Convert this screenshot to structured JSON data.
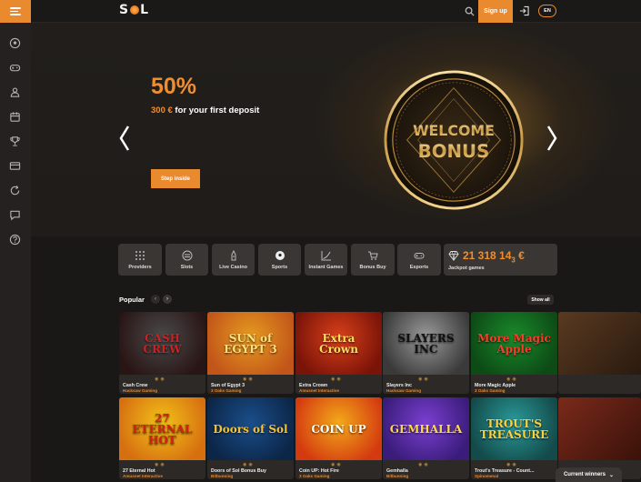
{
  "header": {
    "logo_text": "SOL",
    "signup_label": "Sign up",
    "lang_label": "EN"
  },
  "sidebar": {
    "icons": [
      "soccer-ball-icon",
      "gamepad-icon",
      "dealer-icon",
      "calendar-icon",
      "trophy-icon",
      "card-icon",
      "refresh-bonus-icon",
      "chat-icon",
      "help-icon"
    ]
  },
  "hero": {
    "percent": "50%",
    "amount": "300 €",
    "subtitle_rest": " for your first deposit",
    "cta_label": "Step inside",
    "badge_line1": "WELCOME",
    "badge_line2": "BONUS"
  },
  "categories": [
    {
      "label": "Providers",
      "icon": "grid-icon"
    },
    {
      "label": "Slots",
      "icon": "slot-icon"
    },
    {
      "label": "Live Casino",
      "icon": "dealer-icon"
    },
    {
      "label": "Sports",
      "icon": "soccer-ball-icon"
    },
    {
      "label": "Instant Games",
      "icon": "chart-icon"
    },
    {
      "label": "Bonus Buy",
      "icon": "cart-icon"
    },
    {
      "label": "Esports",
      "icon": "gamepad-icon"
    }
  ],
  "jackpot": {
    "value_main": "21 318 14",
    "value_sub": "3",
    "value_cur": " €",
    "label": "Jackpot games"
  },
  "popular": {
    "title": "Popular",
    "show_all": "Show all",
    "games": [
      {
        "name": "Cash Crew",
        "provider": "Hacksaw Gaming",
        "art": "CASH CREW",
        "colors": [
          "#4a4a4a",
          "#2a1515",
          "#c22"
        ]
      },
      {
        "name": "Sun of Egypt 3",
        "provider": "3 Oaks Gaming",
        "art": "SUN of EGYPT 3",
        "colors": [
          "#e69a1f",
          "#c2561a",
          "#ffe27a"
        ]
      },
      {
        "name": "Extra Crown",
        "provider": "Amusnet Interactive",
        "art": "Extra Crown",
        "colors": [
          "#d8401a",
          "#7a1308",
          "#ffdf5a"
        ]
      },
      {
        "name": "Slayers Inc",
        "provider": "Hacksaw Gaming",
        "art": "SLAYERS INC",
        "colors": [
          "#9a9a9a",
          "#3a3a3a",
          "#111"
        ]
      },
      {
        "name": "More Magic Apple",
        "provider": "3 Oaks Gaming",
        "art": "More Magic Apple",
        "colors": [
          "#1a8a2a",
          "#0d4a16",
          "#ff3a2a"
        ]
      },
      {
        "name": "27 Eternal Hot",
        "provider": "Amusnet Interactive",
        "art": "27 ETERNAL HOT",
        "colors": [
          "#f2c219",
          "#d66f10",
          "#d4200f"
        ]
      },
      {
        "name": "Doors of Sol Bonus Buy",
        "provider": "Bitbunning",
        "art": "Doors of Sol",
        "colors": [
          "#1a4e8a",
          "#0c2648",
          "#f3c23b"
        ]
      },
      {
        "name": "Coin UP: Hot Fire",
        "provider": "3 Oaks Gaming",
        "art": "COIN UP",
        "colors": [
          "#f3a91a",
          "#d43a10",
          "#fff"
        ]
      },
      {
        "name": "Gemhalla",
        "provider": "Bitbunning",
        "art": "GEMHALLA",
        "colors": [
          "#7a3fd0",
          "#3a1c7a",
          "#ffd84a"
        ]
      },
      {
        "name": "Trout's Treasure - Count...",
        "provider": "Spinomenal",
        "art": "TROUT'S TREASURE",
        "colors": [
          "#2a9a9a",
          "#144a4a",
          "#ffcf3a"
        ]
      }
    ]
  },
  "footer": {
    "winners_label": "Current winners"
  },
  "colors": {
    "accent": "#e98a2f",
    "background": "#1a1816",
    "panel": "#3a3633"
  }
}
